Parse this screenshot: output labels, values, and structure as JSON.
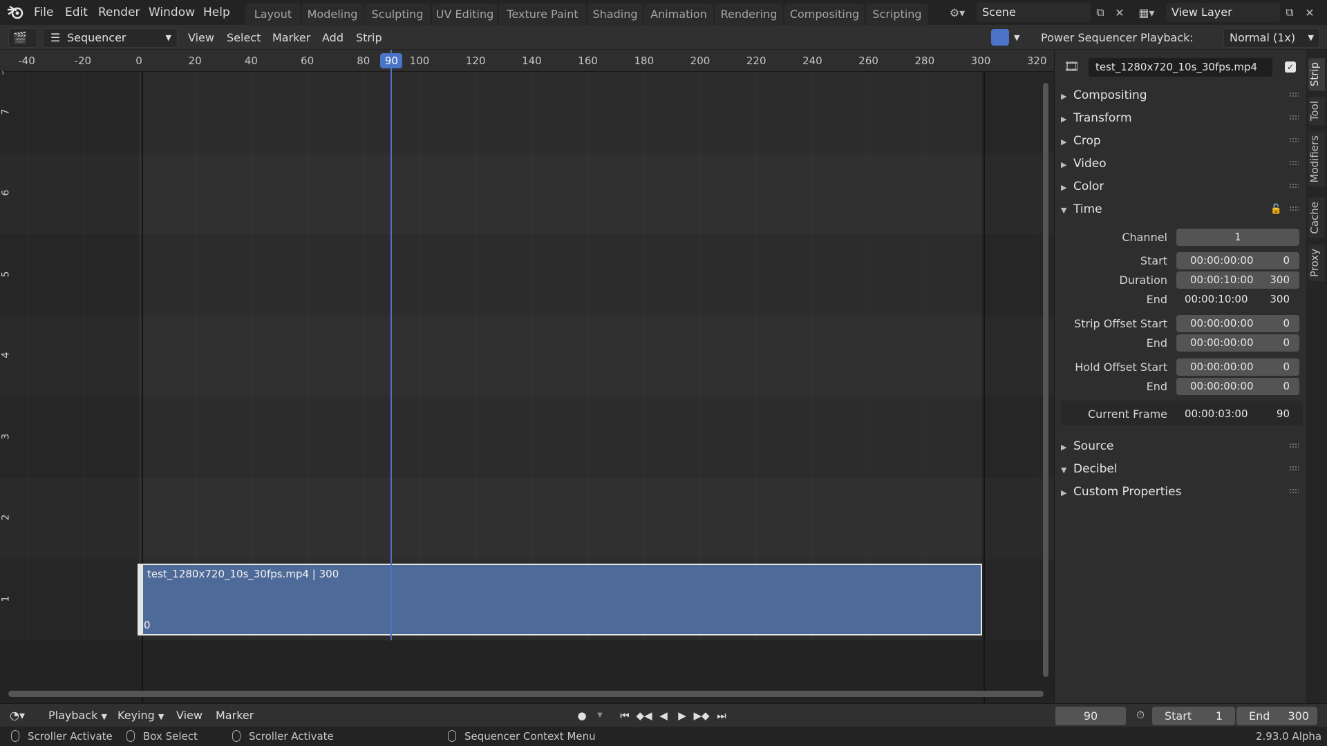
{
  "menu": [
    "File",
    "Edit",
    "Render",
    "Window",
    "Help"
  ],
  "workspaces": [
    "Layout",
    "Modeling",
    "Sculpting",
    "UV Editing",
    "Texture Paint",
    "Shading",
    "Animation",
    "Rendering",
    "Compositing",
    "Scripting"
  ],
  "scene": "Scene",
  "view_layer": "View Layer",
  "header": {
    "editor": "Sequencer",
    "menus": [
      "View",
      "Select",
      "Marker",
      "Add",
      "Strip"
    ],
    "addon": "Power Sequencer",
    "playback_label": "Playback:",
    "playback_value": "Normal (1x)"
  },
  "ruler": {
    "ticks": [
      "-40",
      "-20",
      "0",
      "20",
      "40",
      "60",
      "80",
      "100",
      "120",
      "140",
      "160",
      "180",
      "200",
      "220",
      "240",
      "260",
      "280",
      "300",
      "320"
    ],
    "current_frame": "90"
  },
  "channels": [
    "7",
    "6",
    "5",
    "4",
    "3",
    "2",
    "1"
  ],
  "strip": {
    "title": "test_1280x720_10s_30fps.mp4 | 300",
    "start": "0",
    "channel": 1,
    "frame_start": 0,
    "frame_end": 300
  },
  "sidebar": {
    "strip_name": "test_1280x720_10s_30fps.mp4",
    "panels_top": [
      "Compositing",
      "Transform",
      "Crop",
      "Video",
      "Color",
      "Time"
    ],
    "panels_bottom": [
      "Source",
      "Decibel",
      "Custom Properties"
    ],
    "time": {
      "channel_label": "Channel",
      "channel": "1",
      "start_label": "Start",
      "start_tc": "00:00:00:00",
      "start_fr": "0",
      "duration_label": "Duration",
      "duration_tc": "00:00:10:00",
      "duration_fr": "300",
      "end_label": "End",
      "end_tc": "00:00:10:00",
      "end_fr": "300",
      "offset_start_label": "Strip Offset Start",
      "offset_start_tc": "00:00:00:00",
      "offset_start_fr": "0",
      "offset_end_label": "End",
      "offset_end_tc": "00:00:00:00",
      "offset_end_fr": "0",
      "hold_start_label": "Hold Offset Start",
      "hold_start_tc": "00:00:00:00",
      "hold_start_fr": "0",
      "hold_end_label": "End",
      "hold_end_tc": "00:00:00:00",
      "hold_end_fr": "0",
      "current_label": "Current Frame",
      "current_tc": "00:00:03:00",
      "current_fr": "90"
    },
    "tabs": [
      "Strip",
      "Tool",
      "Modifiers",
      "Cache",
      "Proxy"
    ]
  },
  "timeline": {
    "menus": [
      "Playback",
      "Keying",
      "View",
      "Marker"
    ],
    "frame": "90",
    "start_label": "Start",
    "start": "1",
    "end_label": "End",
    "end": "300"
  },
  "status": {
    "items": [
      "Scroller Activate",
      "Box Select",
      "Scroller Activate",
      "Sequencer Context Menu"
    ],
    "version": "2.93.0 Alpha"
  },
  "colors": {
    "accent": "#4b74c8",
    "strip": "#4e6a98"
  }
}
